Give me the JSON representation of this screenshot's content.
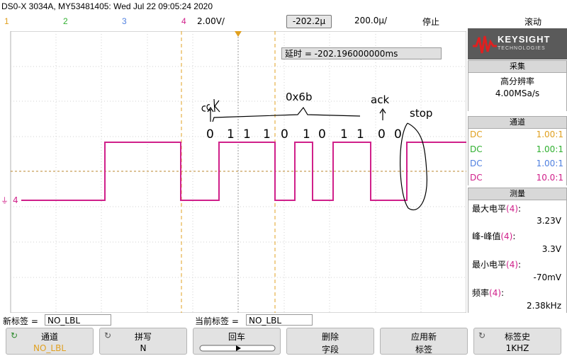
{
  "header": {
    "title": "DS0-X 3034A, MY53481405: Wed Jul 22 09:05:24 2020",
    "channels": [
      {
        "num": "1",
        "color": "#e0a020"
      },
      {
        "num": "2",
        "color": "#30b030"
      },
      {
        "num": "3",
        "color": "#5080e0"
      },
      {
        "num": "4",
        "color": "#d0208a"
      }
    ],
    "scale": "2.00V/",
    "trigger_offset": "-202.2µ",
    "timebase": "200.0µ/",
    "run_state": "停止",
    "trigger_mode": "滚动"
  },
  "plot": {
    "delay_text": "延时 = -202.196000000ms",
    "ground_marker": "4",
    "annotations": [
      "ack",
      "0x6b",
      "ack",
      "stop"
    ],
    "bits": [
      "0",
      "1",
      "1",
      "1",
      "0",
      "1",
      "0",
      "1",
      "1",
      "0",
      "0"
    ],
    "trace_color": "#d0208a"
  },
  "sidebar": {
    "logo": "KEYSIGHT",
    "logo_sub": "TECHNOLOGIES",
    "acquire": {
      "header": "采集",
      "mode": "高分辨率",
      "rate": "4.00MSa/s"
    },
    "channels": {
      "header": "通道",
      "rows": [
        {
          "coupling": "DC",
          "value": "1.00:1",
          "color": "#e0a020"
        },
        {
          "coupling": "DC",
          "value": "1.00:1",
          "color": "#30b030"
        },
        {
          "coupling": "DC",
          "value": "1.00:1",
          "color": "#5080e0"
        },
        {
          "coupling": "DC",
          "value": "10.0:1",
          "color": "#d0208a"
        }
      ]
    },
    "measure": {
      "header": "测量",
      "items": [
        {
          "label": "最大电平",
          "ch": "(4)",
          "colon": ":",
          "value": "3.23V"
        },
        {
          "label": "峰-峰值",
          "ch": "(4)",
          "colon": ":",
          "value": "3.3V"
        },
        {
          "label": "最小电平",
          "ch": "(4)",
          "colon": ":",
          "value": "-70mV"
        },
        {
          "label": "频率",
          "ch": "(4)",
          "colon": ":",
          "value": "2.38kHz"
        }
      ]
    }
  },
  "labels": {
    "new_label": "新标签 =",
    "new_value": "NO_LBL",
    "current_label": "当前标签 =",
    "current_value": "NO_LBL"
  },
  "softkeys": [
    {
      "line1": "通道",
      "line2": "NO_LBL",
      "icon": "↻"
    },
    {
      "line1": "拼写",
      "line2": "N",
      "icon": "↻"
    },
    {
      "line1": "回车",
      "line2": ""
    },
    {
      "line1": "删除",
      "line2": "字段"
    },
    {
      "line1": "应用新",
      "line2": "标签"
    },
    {
      "line1": "标签史",
      "line2": "1KHZ",
      "icon": "↻"
    }
  ]
}
